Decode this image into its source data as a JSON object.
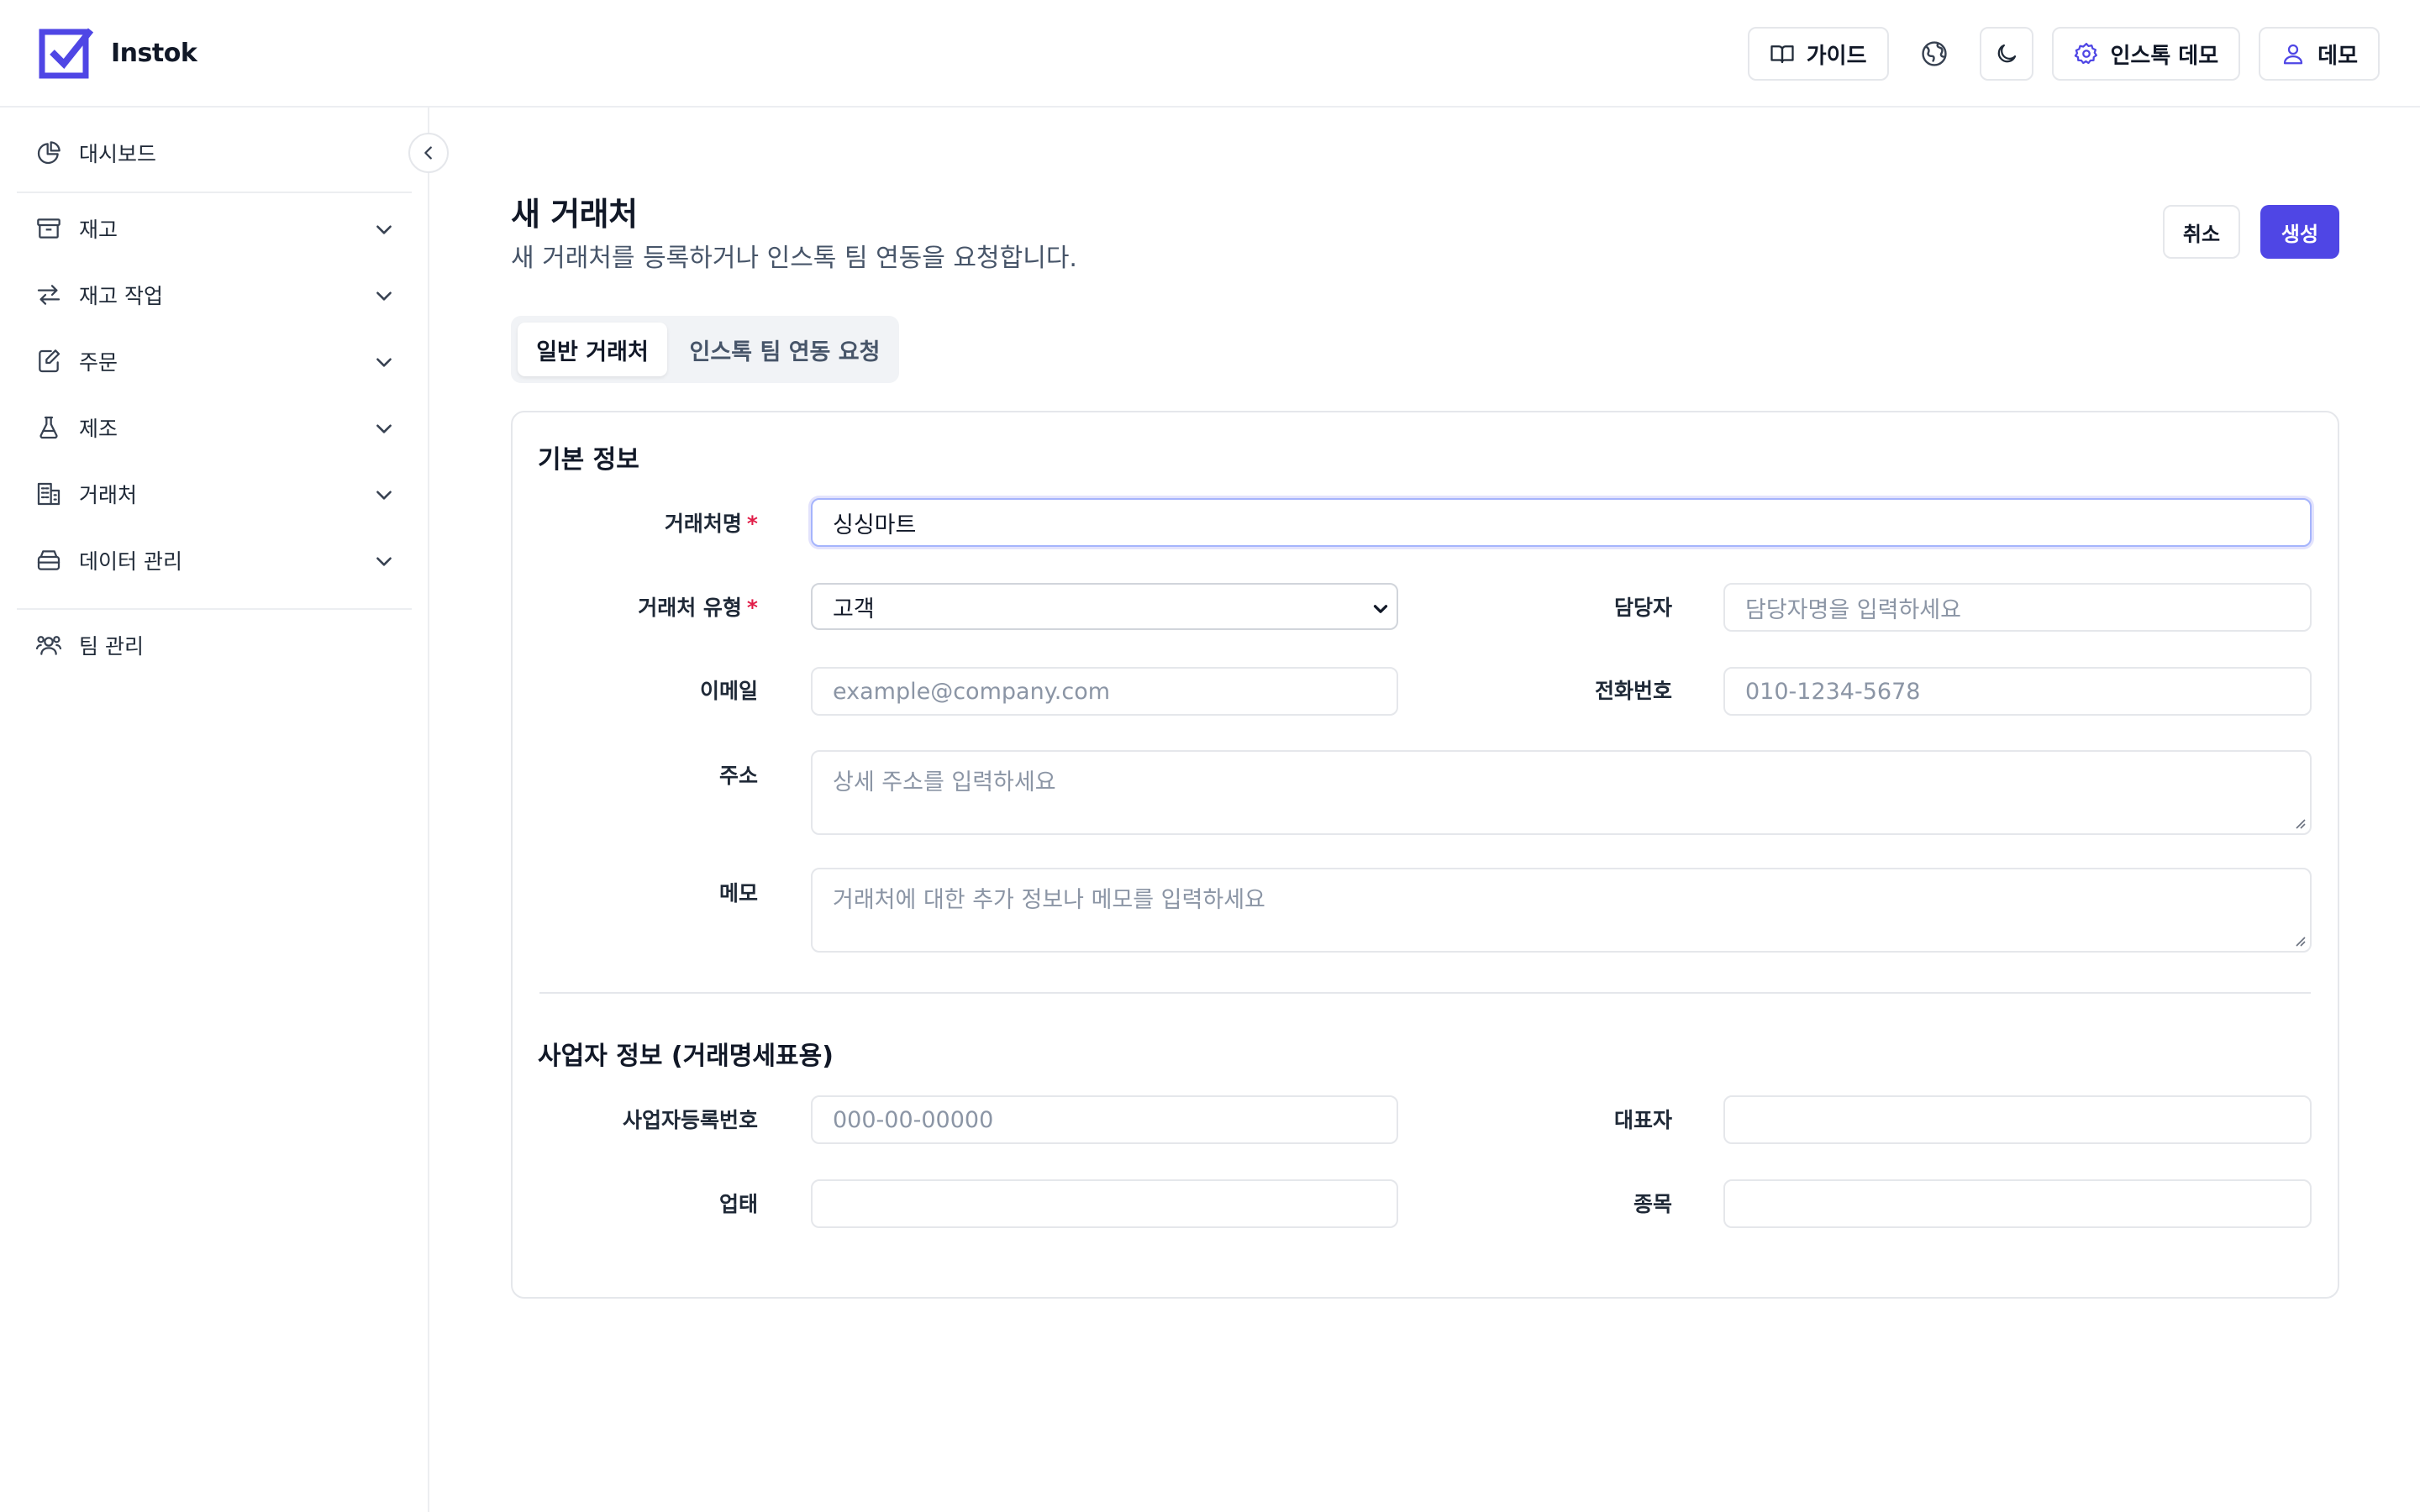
{
  "brand": {
    "name": "Instok"
  },
  "topbar": {
    "guide_label": "가이드",
    "workspace_label": "인스톡 데모",
    "user_label": "데모"
  },
  "sidebar": {
    "items": [
      {
        "label": "대시보드",
        "icon": "pie-chart-icon"
      },
      {
        "label": "재고",
        "icon": "archive-box-icon"
      },
      {
        "label": "재고 작업",
        "icon": "arrows-swap-icon"
      },
      {
        "label": "주문",
        "icon": "edit-document-icon"
      },
      {
        "label": "제조",
        "icon": "flask-icon"
      },
      {
        "label": "거래처",
        "icon": "building-icon"
      },
      {
        "label": "데이터 관리",
        "icon": "database-icon"
      },
      {
        "label": "팀 관리",
        "icon": "users-icon"
      }
    ]
  },
  "page": {
    "title": "새 거래처",
    "subtitle": "새 거래처를 등록하거나 인스톡 팀 연동을 요청합니다.",
    "cancel_label": "취소",
    "create_label": "생성"
  },
  "tabs": [
    {
      "label": "일반 거래처",
      "active": true
    },
    {
      "label": "인스톡 팀 연동 요청",
      "active": false
    }
  ],
  "basic": {
    "title": "기본 정보",
    "name_label": "거래처명",
    "name_value": "싱싱마트",
    "type_label": "거래처 유형",
    "type_value": "고객",
    "manager_label": "담당자",
    "manager_placeholder": "담당자명을 입력하세요",
    "email_label": "이메일",
    "email_placeholder": "example@company.com",
    "phone_label": "전화번호",
    "phone_placeholder": "010-1234-5678",
    "address_label": "주소",
    "address_placeholder": "상세 주소를 입력하세요",
    "memo_label": "메모",
    "memo_placeholder": "거래처에 대한 추가 정보나 메모를 입력하세요",
    "required_mark": "*"
  },
  "business": {
    "title": "사업자 정보 (거래명세표용)",
    "reg_label": "사업자등록번호",
    "reg_placeholder": "000-00-00000",
    "ceo_label": "대표자",
    "ceo_value": "",
    "biz_type_label": "업태",
    "biz_type_value": "",
    "item_label": "종목",
    "item_value": ""
  },
  "colors": {
    "accent": "#4f46e5",
    "required": "#e11d48",
    "border": "#e5e7eb"
  }
}
